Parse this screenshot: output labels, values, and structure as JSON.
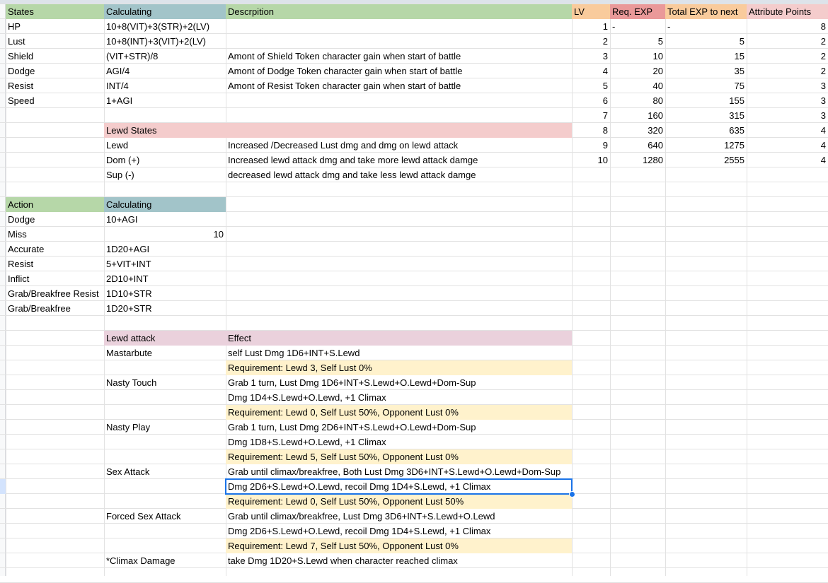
{
  "colors": {
    "green": "#b6d7a8",
    "teal": "#a2c4c9",
    "pink": "#f4cccc",
    "mauve": "#ead1dc",
    "yellow": "#fff2cc",
    "orange": "#f9cb9c",
    "salmon": "#ea9999",
    "lightred": "#f4cccc",
    "selection": "#1a73e8"
  },
  "states_table": {
    "header": [
      "States",
      "Calculating",
      "Descrpition"
    ],
    "rows": [
      [
        "HP",
        "10+8(VIT)+3(STR)+2(LV)",
        ""
      ],
      [
        "Lust",
        "10+8(INT)+3(VIT)+2(LV)",
        ""
      ],
      [
        "Shield",
        "(VIT+STR)/8",
        "Amont of Shield Token character gain when start of battle"
      ],
      [
        "Dodge",
        "AGI/4",
        "Amont of Dodge Token character gain when start of battle"
      ],
      [
        "Resist",
        "INT/4",
        "Amont of Resist Token character gain when start of battle"
      ],
      [
        "Speed",
        "1+AGI",
        ""
      ]
    ]
  },
  "lewd_states": {
    "header": "Lewd States",
    "rows": [
      [
        "Lewd",
        "Increased /Decreased Lust dmg and dmg on lewd attack"
      ],
      [
        "Dom (+)",
        "Increased lewd attack dmg and take more lewd attack damge"
      ],
      [
        "Sup (-)",
        "decreased lewd attack dmg and take less lewd attack damge"
      ]
    ]
  },
  "level_table": {
    "header": [
      "LV",
      "Req. EXP",
      "Total EXP to next",
      "Attribute Points"
    ],
    "rows": [
      [
        "1",
        "-",
        "-",
        "8"
      ],
      [
        "2",
        "5",
        "5",
        "2"
      ],
      [
        "3",
        "10",
        "15",
        "2"
      ],
      [
        "4",
        "20",
        "35",
        "2"
      ],
      [
        "5",
        "40",
        "75",
        "3"
      ],
      [
        "6",
        "80",
        "155",
        "3"
      ],
      [
        "7",
        "160",
        "315",
        "3"
      ],
      [
        "8",
        "320",
        "635",
        "4"
      ],
      [
        "9",
        "640",
        "1275",
        "4"
      ],
      [
        "10",
        "1280",
        "2555",
        "4"
      ]
    ]
  },
  "action_table": {
    "header": [
      "Action",
      "Calculating"
    ],
    "rows": [
      [
        "Dodge",
        "10+AGI"
      ],
      [
        "Miss",
        "10"
      ],
      [
        "Accurate",
        "1D20+AGI"
      ],
      [
        "Resist",
        "5+VIT+INT"
      ],
      [
        "Inflict",
        "2D10+INT"
      ],
      [
        "Grab/Breakfree Resist",
        "1D10+STR"
      ],
      [
        "Grab/Breakfree",
        "1D20+STR"
      ]
    ]
  },
  "lewd_attack_table": {
    "header": [
      "Lewd attack",
      "Effect"
    ],
    "rows": [
      [
        "Mastarbute",
        "self Lust Dmg 1D6+INT+S.Lewd"
      ],
      [
        "",
        "Requirement: Lewd 3, Self Lust 0%"
      ],
      [
        "Nasty Touch",
        "Grab 1 turn, Lust Dmg 1D6+INT+S.Lewd+O.Lewd+Dom-Sup"
      ],
      [
        "",
        "Dmg 1D4+S.Lewd+O.Lewd, +1 Climax"
      ],
      [
        "",
        "Requirement: Lewd 0, Self Lust 50%, Opponent Lust 0%"
      ],
      [
        "Nasty Play",
        "Grab 1 turn, Lust Dmg 2D6+INT+S.Lewd+O.Lewd+Dom-Sup"
      ],
      [
        "",
        "Dmg 1D8+S.Lewd+O.Lewd, +1 Climax"
      ],
      [
        "",
        "Requirement: Lewd 5, Self Lust 50%, Opponent Lust 0%"
      ],
      [
        "Sex Attack",
        "Grab until climax/breakfree, Both Lust Dmg 3D6+INT+S.Lewd+O.Lewd+Dom-Sup"
      ],
      [
        "",
        "Dmg 2D6+S.Lewd+O.Lewd, recoil Dmg 1D4+S.Lewd, +1 Climax"
      ],
      [
        "",
        "Requirement: Lewd 0, Self Lust 50%, Opponent Lust 50%"
      ],
      [
        "Forced Sex Attack",
        "Grab until climax/breakfree, Lust Dmg 3D6+INT+S.Lewd+O.Lewd"
      ],
      [
        "",
        "Dmg 2D6+S.Lewd+O.Lewd, recoil Dmg 1D4+S.Lewd, +1 Climax"
      ],
      [
        "",
        "Requirement: Lewd 7, Self Lust 50%, Opponent Lust 0%"
      ],
      [
        "*Climax Damage",
        "take Dmg 1D20+S.Lewd when character reached climax"
      ]
    ]
  }
}
